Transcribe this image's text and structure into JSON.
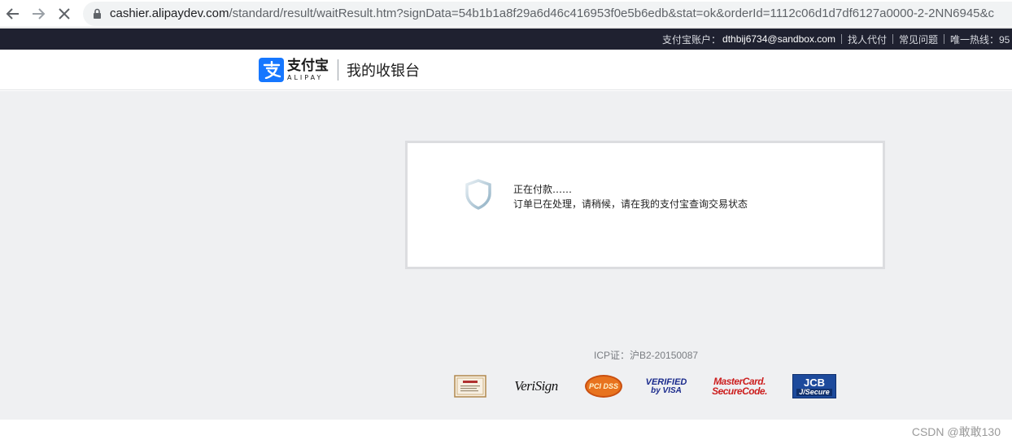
{
  "browser": {
    "url_host": "cashier.alipaydev.com",
    "url_rest": "/standard/result/waitResult.htm?signData=54b1b1a8f29a6d46c416953f0e5b6edb&stat=ok&orderId=1112c06d1d7df6127a0000-2-2NN6945&c"
  },
  "topbar": {
    "account_label": "支付宝账户：",
    "account_email": "dthbij6734@sandbox.com",
    "links": [
      "找人代付",
      "常见问题",
      "唯一热线：95"
    ]
  },
  "header": {
    "logo_cn": "支付宝",
    "logo_en": "ALIPAY",
    "title": "我的收银台"
  },
  "result": {
    "title": "正在付款……",
    "description": "订单已在处理，请稍候，请在我的支付宝查询交易状态"
  },
  "footer": {
    "icp": "ICP证：沪B2-20150087",
    "badges": {
      "verisign": "VeriSign",
      "pcidss": "PCI DSS",
      "verified_line1": "VERIFIED",
      "verified_line2": "by VISA",
      "mastercard_line1": "MasterCard.",
      "mastercard_line2": "SecureCode.",
      "jcb_line1": "JCB",
      "jcb_line2": "J/Secure"
    }
  },
  "watermark": "CSDN @敢敢130",
  "colors": {
    "alipay_blue": "#1677ff",
    "topbar_bg": "#1f2130",
    "page_bg": "#eff0f2"
  }
}
